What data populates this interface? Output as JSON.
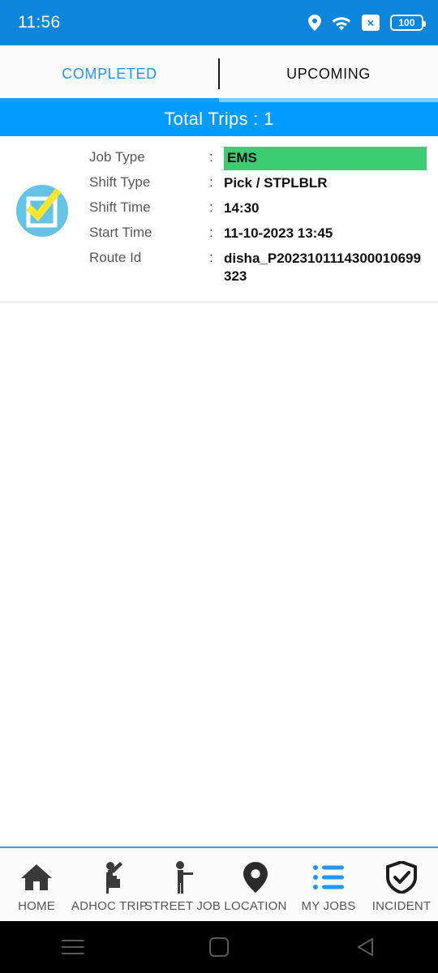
{
  "status_bar": {
    "time": "11:56",
    "battery_level": "100",
    "icons": [
      "location-pin-icon",
      "wifi-icon",
      "sim-error-icon",
      "battery-icon"
    ],
    "background_color": "#0b86da"
  },
  "tabs": [
    {
      "label": "COMPLETED",
      "active": true
    },
    {
      "label": "UPCOMING",
      "active": false
    }
  ],
  "banner": {
    "text": "Total Trips : 1",
    "background_color": "#029bff"
  },
  "trip_card": {
    "status_icon": "checked-checkbox-icon",
    "rows": [
      {
        "label": "Job Type",
        "separator": ":",
        "value": "EMS",
        "highlight": true,
        "highlight_color": "#3ecc72"
      },
      {
        "label": "Shift Type",
        "separator": ":",
        "value": "Pick / STPLBLR",
        "highlight": false
      },
      {
        "label": "Shift Time",
        "separator": ":",
        "value": "14:30",
        "highlight": false
      },
      {
        "label": "Start Time",
        "separator": ":",
        "value": "11-10-2023 13:45",
        "highlight": false
      },
      {
        "label": "Route Id",
        "separator": ":",
        "value": "disha_P2023101114300010699323",
        "highlight": false
      }
    ]
  },
  "bottom_nav": {
    "accent_color": "#28a4ef",
    "items": [
      {
        "label": "HOME",
        "icon": "home-icon",
        "active": false
      },
      {
        "label": "ADHOC TRIP",
        "icon": "hailing-person-icon",
        "active": false
      },
      {
        "label": "STREET JOB",
        "icon": "standing-person-icon",
        "active": false
      },
      {
        "label": "LOCATION",
        "icon": "map-pin-icon",
        "active": false
      },
      {
        "label": "MY JOBS",
        "icon": "list-icon",
        "active": true
      },
      {
        "label": "INCIDENT",
        "icon": "shield-check-icon",
        "active": false
      }
    ]
  },
  "system_nav": {
    "buttons": [
      "recents-icon",
      "home-square-icon",
      "back-triangle-icon"
    ]
  }
}
